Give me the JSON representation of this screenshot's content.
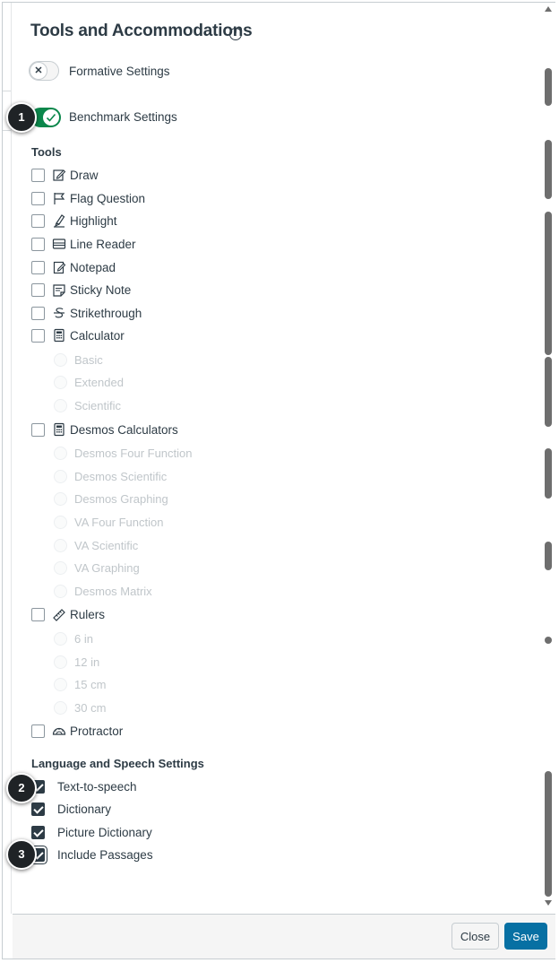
{
  "dialog": {
    "title": "Tools and Accommodations",
    "info_icon": "info-icon"
  },
  "settings": {
    "formative_label": "Formative Settings",
    "formative_on": false,
    "benchmark_label": "Benchmark Settings",
    "benchmark_on": true
  },
  "tools": {
    "heading": "Tools",
    "items": {
      "draw": {
        "label": "Draw",
        "icon": "draw-icon",
        "checked": false
      },
      "flag": {
        "label": "Flag Question",
        "icon": "flag-icon",
        "checked": false
      },
      "highlight": {
        "label": "Highlight",
        "icon": "highlighter-icon",
        "checked": false
      },
      "line_reader": {
        "label": "Line Reader",
        "icon": "line-reader-icon",
        "checked": false
      },
      "notepad": {
        "label": "Notepad",
        "icon": "notepad-icon",
        "checked": false
      },
      "sticky": {
        "label": "Sticky Note",
        "icon": "sticky-note-icon",
        "checked": false
      },
      "strike": {
        "label": "Strikethrough",
        "icon": "strikethrough-icon",
        "checked": false
      },
      "calculator": {
        "label": "Calculator",
        "icon": "calculator-icon",
        "checked": false
      },
      "desmos": {
        "label": "Desmos Calculators",
        "icon": "calculator-icon",
        "checked": false
      },
      "rulers": {
        "label": "Rulers",
        "icon": "ruler-icon",
        "checked": false
      },
      "protractor": {
        "label": "Protractor",
        "icon": "protractor-icon",
        "checked": false
      }
    },
    "calculator_options": [
      "Basic",
      "Extended",
      "Scientific"
    ],
    "desmos_options": [
      "Desmos Four Function",
      "Desmos Scientific",
      "Desmos Graphing",
      "VA Four Function",
      "VA Scientific",
      "VA Graphing",
      "Desmos Matrix"
    ],
    "ruler_options": [
      "6 in",
      "12 in",
      "15 cm",
      "30 cm"
    ]
  },
  "language": {
    "heading": "Language and Speech Settings",
    "items": {
      "tts": {
        "label": "Text-to-speech",
        "checked": true
      },
      "dictionary": {
        "label": "Dictionary",
        "checked": true
      },
      "picture_dictionary": {
        "label": "Picture Dictionary",
        "checked": true
      },
      "include_passages": {
        "label": "Include Passages",
        "checked": true
      }
    }
  },
  "callouts": [
    "1",
    "2",
    "3"
  ],
  "footer": {
    "close_label": "Close",
    "save_label": "Save"
  },
  "colors": {
    "toggle_on": "#0b874b",
    "save_button": "#0770a3",
    "text": "#2d3b45"
  }
}
